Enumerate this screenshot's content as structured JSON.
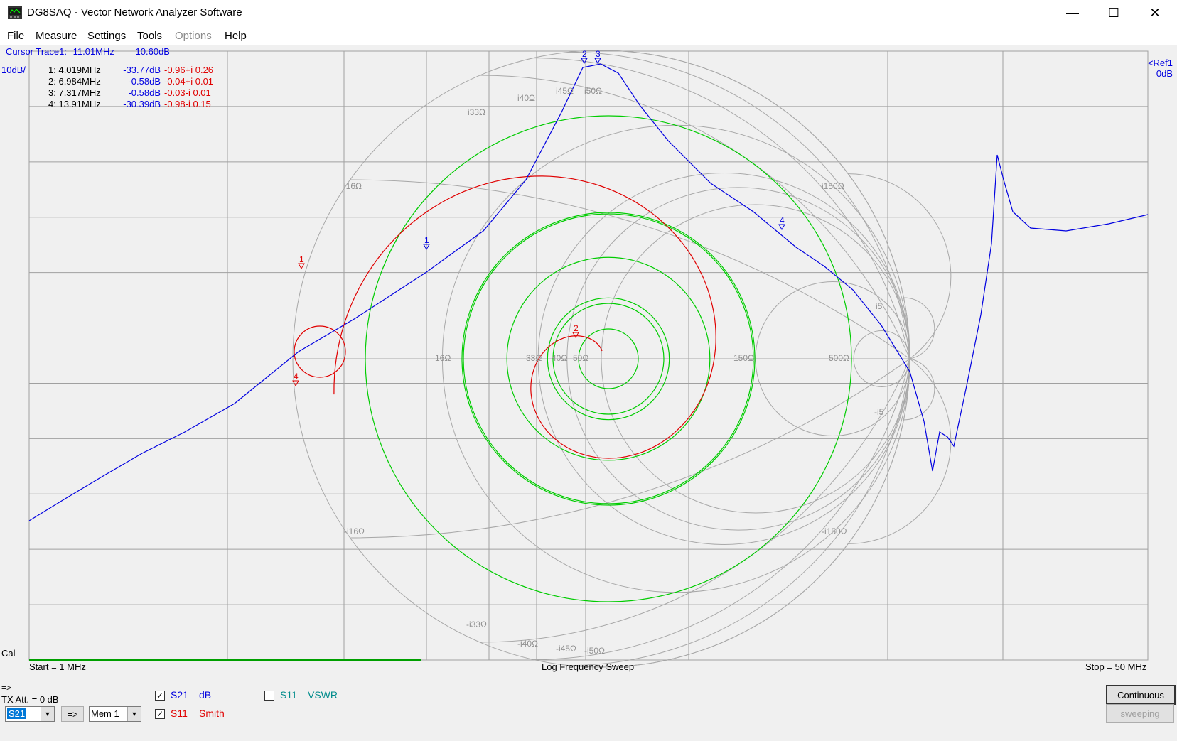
{
  "window": {
    "title": "DG8SAQ  -  Vector Network Analyzer Software",
    "minimize_glyph": "—",
    "maximize_glyph": "☐",
    "close_glyph": "✕",
    "icon": "vna-app-icon"
  },
  "menu": {
    "items": [
      {
        "label": "File",
        "hot": "F",
        "rest": "ile",
        "enabled": true
      },
      {
        "label": "Measure",
        "hot": "M",
        "rest": "easure",
        "enabled": true
      },
      {
        "label": "Settings",
        "hot": "S",
        "rest": "ettings",
        "enabled": true
      },
      {
        "label": "Tools",
        "hot": "T",
        "rest": "ools",
        "enabled": true
      },
      {
        "label": "Options",
        "hot": "O",
        "rest": "ptions",
        "enabled": false
      },
      {
        "label": "Help",
        "hot": "H",
        "rest": "elp",
        "enabled": true
      }
    ]
  },
  "cursor": {
    "label": "Cursor Trace1:",
    "freq": "11.01MHz",
    "value": "10.60dB"
  },
  "scale": {
    "per_div": "10dB/",
    "ref1": "<Ref1",
    "ref_value": "0dB"
  },
  "markers": [
    {
      "id": "1:",
      "freq": "4.019MHz",
      "s21": "-33.77dB",
      "s11": "-0.96+i 0.26"
    },
    {
      "id": "2:",
      "freq": "6.984MHz",
      "s21": "-0.58dB",
      "s11": "-0.04+i 0.01"
    },
    {
      "id": "3:",
      "freq": "7.317MHz",
      "s21": "-0.58dB",
      "s11": "-0.03-i 0.01"
    },
    {
      "id": "4:",
      "freq": "13.91MHz",
      "s21": "-30.39dB",
      "s11": "-0.98-i 0.15"
    }
  ],
  "sweep": {
    "cal": "Cal",
    "start": "Start = 1 MHz",
    "center": "Log Frequency Sweep",
    "stop": "Stop = 50 MHz"
  },
  "smith_labels": {
    "r16": "16Ω",
    "r33": "33Ω",
    "r40": "40Ω",
    "r50": "50Ω",
    "r150": "150Ω",
    "r500": "500Ω",
    "x16p": "i16Ω",
    "x16n": "-i16Ω",
    "x33p": "i33Ω",
    "x33n": "-i33Ω",
    "x40p": "i40Ω",
    "x40n": "-i40Ω",
    "x45p": "i45Ω",
    "x45n": "-i45Ω",
    "x50p": "i50Ω",
    "x50n": "-i50Ω",
    "x150p": "i150Ω",
    "x150n": "-i150Ω",
    "x5p": "i5",
    "x5n": "-i5"
  },
  "trace_markers": {
    "m1": "1",
    "m2": "2",
    "m3": "3",
    "m4": "4",
    "s1": "1",
    "s2": "2",
    "s4": "4"
  },
  "controls": {
    "arrow": "=>",
    "tx_att": "TX Att.  = 0 dB",
    "param_select": "S21",
    "copy_button": "=>",
    "mem_select": "Mem 1",
    "trace1": {
      "checked": true,
      "param": "S21",
      "format": "dB"
    },
    "trace2": {
      "checked": true,
      "param": "S11",
      "format": "Smith"
    },
    "trace3": {
      "checked": false,
      "param": "S11",
      "format": "VSWR"
    },
    "continuous": "Continuous",
    "sweeping": "sweeping"
  },
  "colors": {
    "s21": "#0000e0",
    "s11": "#e00000",
    "vswr": "#008c8c",
    "circles": "#00cc00",
    "grid": "#a0a0a0"
  }
}
